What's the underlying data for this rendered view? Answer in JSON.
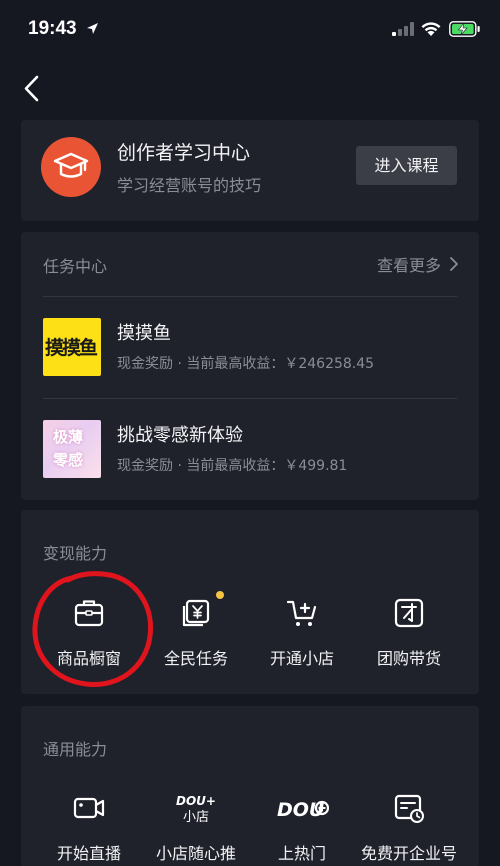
{
  "status_bar": {
    "time": "19:43"
  },
  "learn_center": {
    "title": "创作者学习中心",
    "subtitle": "学习经营账号的技巧",
    "button_label": "进入课程",
    "colors": {
      "logo_bg": "#e95534"
    }
  },
  "task_center": {
    "title": "任务中心",
    "more_label": "查看更多",
    "items": [
      {
        "name": "摸摸鱼",
        "desc": "现金奖励 · 当前最高收益：￥246258.45",
        "thumb_text": "摸摸鱼"
      },
      {
        "name": "挑战零感新体验",
        "desc": "现金奖励 · 当前最高收益：￥499.81",
        "thumb_text_1": "极薄",
        "thumb_text_2": "零感"
      }
    ]
  },
  "monetization": {
    "title": "变现能力",
    "items": [
      {
        "label": "商品橱窗",
        "icon": "shop-bag-icon"
      },
      {
        "label": "全民任务",
        "icon": "task-yen-icon"
      },
      {
        "label": "开通小店",
        "icon": "cart-plus-icon"
      },
      {
        "label": "团购带货",
        "icon": "group-buy-icon"
      }
    ]
  },
  "general": {
    "title": "通用能力",
    "items": [
      {
        "label": "开始直播",
        "icon": "live-camera-icon"
      },
      {
        "label": "小店随心推",
        "icon": "dou-plus-shop-icon",
        "logo_line1": "DOU+",
        "logo_line2": "小店"
      },
      {
        "label": "上热门",
        "icon": "dou-plus-icon",
        "logo_text": "DOU"
      },
      {
        "label": "免费开企业号",
        "icon": "enterprise-account-icon"
      }
    ]
  },
  "colors": {
    "background": "#151721",
    "card": "#1f212b",
    "muted_text": "#8b8d96",
    "annotation_red": "#e0141c",
    "notification_dot": "#f6c343"
  }
}
